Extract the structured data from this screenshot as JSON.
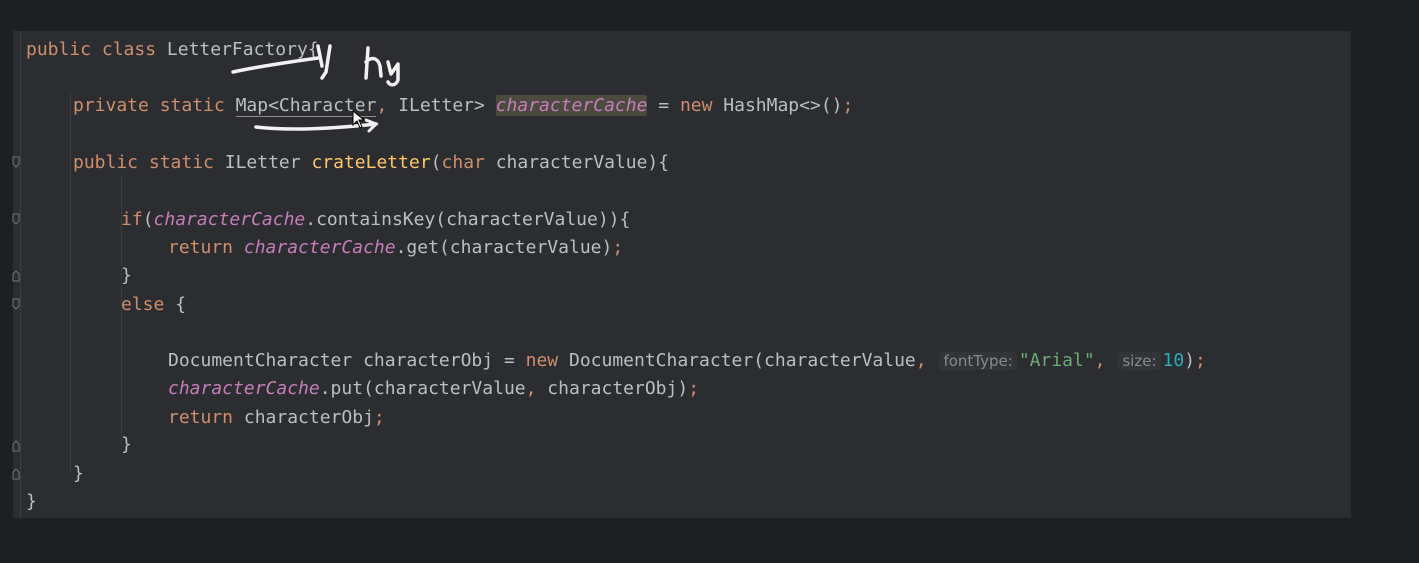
{
  "code": {
    "l1": {
      "kw1": "public",
      "kw2": "class",
      "name": "LetterFactory",
      "brace": "{"
    },
    "l2": {
      "kw1": "private",
      "kw2": "static",
      "type_a": "Map<Character",
      "comma1": ",",
      "type_b": " ILetter>",
      "field": "characterCache",
      "eq": " = ",
      "kw3": "new",
      "rest": " HashMap<>()",
      "semi": ";"
    },
    "l3": {
      "kw1": "public",
      "kw2": "static",
      "rtype": " ILetter ",
      "method": "crateLetter",
      "paren": "(",
      "kw3": "char",
      "param": " characterValue){"
    },
    "l4": {
      "kw": "if",
      "paren": "(",
      "field": "characterCache",
      "rest": ".containsKey(characterValue)){"
    },
    "l5": {
      "kw": "return",
      "field": "characterCache",
      "rest": ".get(characterValue)",
      "semi": ";"
    },
    "l6": {
      "text": "}"
    },
    "l7": {
      "kw": "else",
      "rest": " {"
    },
    "l8": {
      "pre": "DocumentCharacter characterObj = ",
      "kw": "new",
      "mid": " DocumentCharacter(characterValue",
      "comma1": ",",
      "hint1": "fontType:",
      "str": "\"Arial\"",
      "comma2": ",",
      "hint2": "size:",
      "num": "10",
      "end": ")",
      "semi": ";"
    },
    "l9": {
      "field": "characterCache",
      "rest": ".put(characterValue",
      "comma": ",",
      "rest2": " characterObj)",
      "semi": ";"
    },
    "l10": {
      "kw": "return",
      "rest": " characterObj",
      "semi": ";"
    },
    "l11": {
      "text": "}"
    },
    "l12": {
      "text": "}"
    },
    "l13": {
      "text": "}"
    }
  },
  "annotation": {
    "handwriting": "Hy"
  },
  "icons": {
    "cursor": "mouse-pointer-icon",
    "fold": "fold-marker-icon"
  }
}
